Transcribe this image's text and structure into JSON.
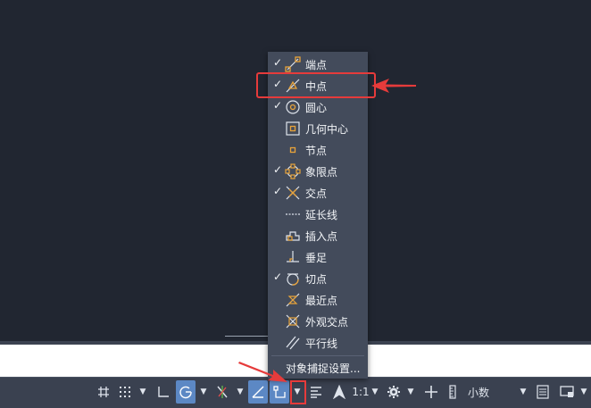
{
  "osnap_menu": {
    "items": [
      {
        "label": "端点",
        "checked": true,
        "icon": "endpoint-icon"
      },
      {
        "label": "中点",
        "checked": true,
        "icon": "midpoint-icon"
      },
      {
        "label": "圆心",
        "checked": true,
        "icon": "center-icon"
      },
      {
        "label": "几何中心",
        "checked": false,
        "icon": "geometric-center-icon"
      },
      {
        "label": "节点",
        "checked": false,
        "icon": "node-icon"
      },
      {
        "label": "象限点",
        "checked": true,
        "icon": "quadrant-icon"
      },
      {
        "label": "交点",
        "checked": true,
        "icon": "intersection-icon"
      },
      {
        "label": "延长线",
        "checked": false,
        "icon": "extension-icon"
      },
      {
        "label": "插入点",
        "checked": false,
        "icon": "insertion-icon"
      },
      {
        "label": "垂足",
        "checked": false,
        "icon": "perpendicular-icon"
      },
      {
        "label": "切点",
        "checked": true,
        "icon": "tangent-icon"
      },
      {
        "label": "最近点",
        "checked": false,
        "icon": "nearest-icon"
      },
      {
        "label": "外观交点",
        "checked": false,
        "icon": "apparent-intersection-icon"
      },
      {
        "label": "平行线",
        "checked": false,
        "icon": "parallel-icon"
      }
    ],
    "settings_label": "对象捕捉设置...",
    "check_mark": "✓"
  },
  "status_bar": {
    "scale": "1:1",
    "units": "小数",
    "arrow": "▼"
  },
  "colors": {
    "accent": "#5c88c4",
    "highlight": "#e63b3b",
    "icon_orange": "#e8a33a"
  }
}
